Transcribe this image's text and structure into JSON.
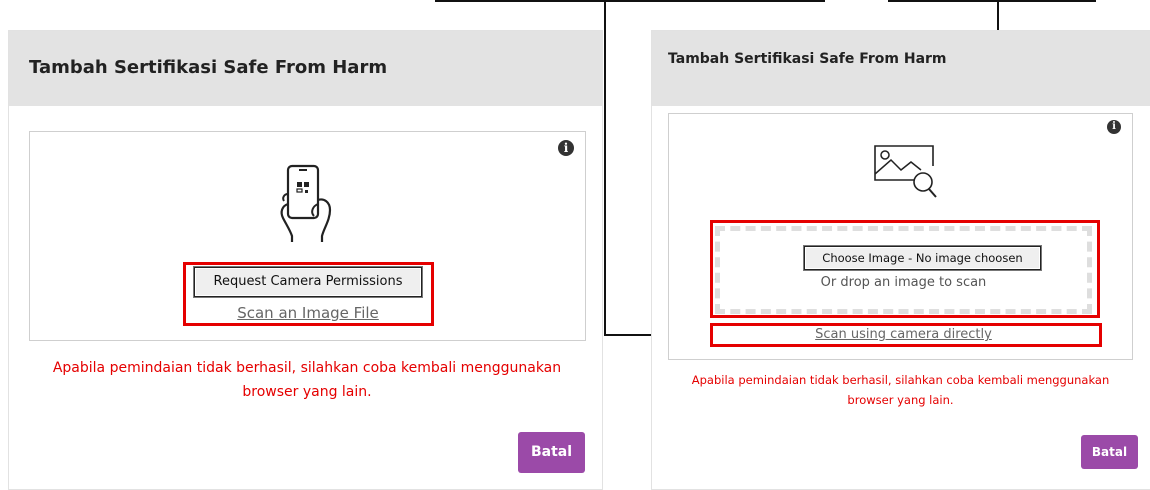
{
  "left_panel": {
    "title": "Tambah Sertifikasi Safe From Harm",
    "request_camera_label": "Request Camera Permissions",
    "scan_file_link": "Scan an Image File",
    "error_message": "Apabila pemindaian tidak berhasil, silahkan coba kembali menggunakan browser yang lain.",
    "cancel_label": "Batal"
  },
  "right_panel": {
    "title": "Tambah Sertifikasi Safe From Harm",
    "choose_image_label": "Choose Image - No image choosen",
    "drop_hint": "Or drop an image to scan",
    "scan_camera_link": "Scan using camera directly",
    "error_message": "Apabila pemindaian tidak berhasil, silahkan coba kembali menggunakan browser yang lain.",
    "cancel_label": "Batal"
  },
  "icons": {
    "info": "info-icon",
    "phone_scan": "phone-qr-scan-icon",
    "image_search": "image-search-icon"
  },
  "colors": {
    "highlight": "#e50000",
    "error_text": "#e50000",
    "cancel_button": "#9b4aa8",
    "header_bg": "#e3e3e3"
  }
}
